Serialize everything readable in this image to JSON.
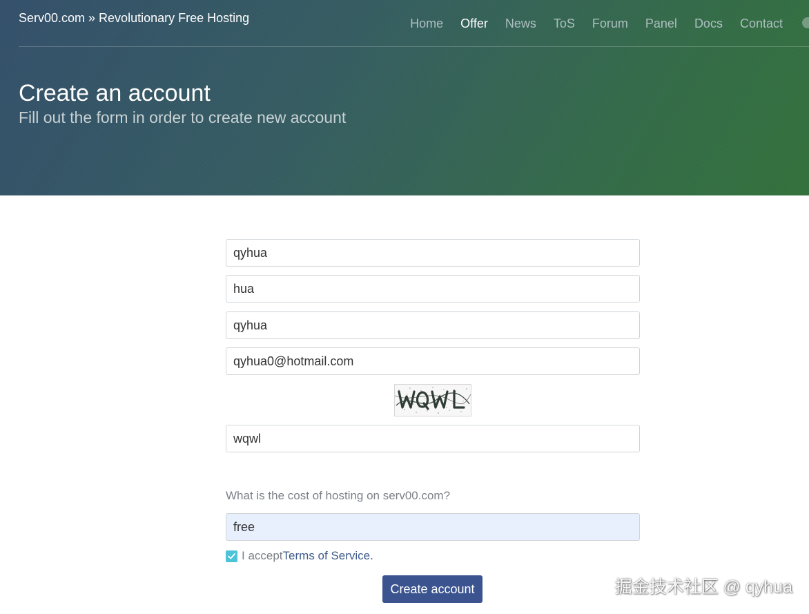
{
  "header": {
    "brand": "Serv00.com » Revolutionary Free Hosting",
    "nav": [
      {
        "label": "Home",
        "active": false
      },
      {
        "label": "Offer",
        "active": true
      },
      {
        "label": "News",
        "active": false
      },
      {
        "label": "ToS",
        "active": false
      },
      {
        "label": "Forum",
        "active": false
      },
      {
        "label": "Panel",
        "active": false
      },
      {
        "label": "Docs",
        "active": false
      },
      {
        "label": "Contact",
        "active": false
      }
    ],
    "title": "Create an account",
    "subtitle": "Fill out the form in order to create new account"
  },
  "form": {
    "fields": [
      {
        "value": "qyhua"
      },
      {
        "value": "hua"
      },
      {
        "value": "qyhua"
      },
      {
        "value": "qyhua0@hotmail.com"
      }
    ],
    "captcha_text": "WQWL",
    "captcha_answer": "wqwl",
    "question": "What is the cost of hosting on serv00.com?",
    "answer": "free",
    "accept_prefix": "I accept ",
    "tos_link": "Terms of Service.",
    "accepted": true,
    "submit_label": "Create account"
  },
  "colors": {
    "submit_button": "#3b5490",
    "checkbox": "#4cc3d9",
    "link": "#3d5a8a"
  },
  "watermark": "掘金技术社区 @ qyhua"
}
